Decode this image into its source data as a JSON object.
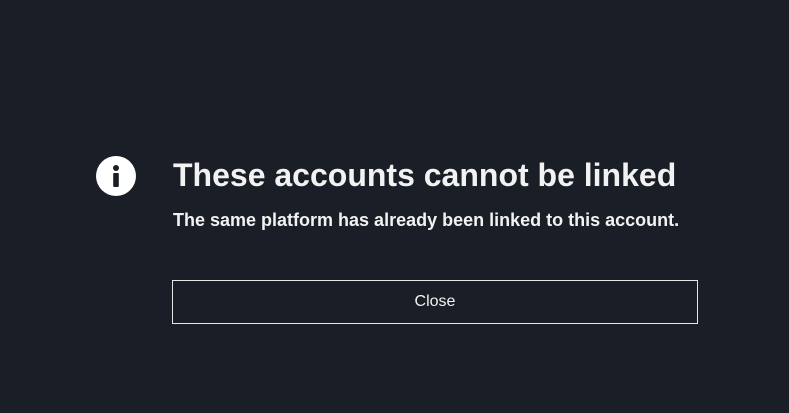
{
  "dialog": {
    "icon": "info-icon",
    "title": "These accounts cannot be linked",
    "message": "The same platform has already been linked to this account.",
    "close_label": "Close"
  },
  "colors": {
    "background": "#1a1e26",
    "text": "#f2f2f2",
    "icon_fill": "#ffffff",
    "button_border": "#e6e6e6"
  }
}
